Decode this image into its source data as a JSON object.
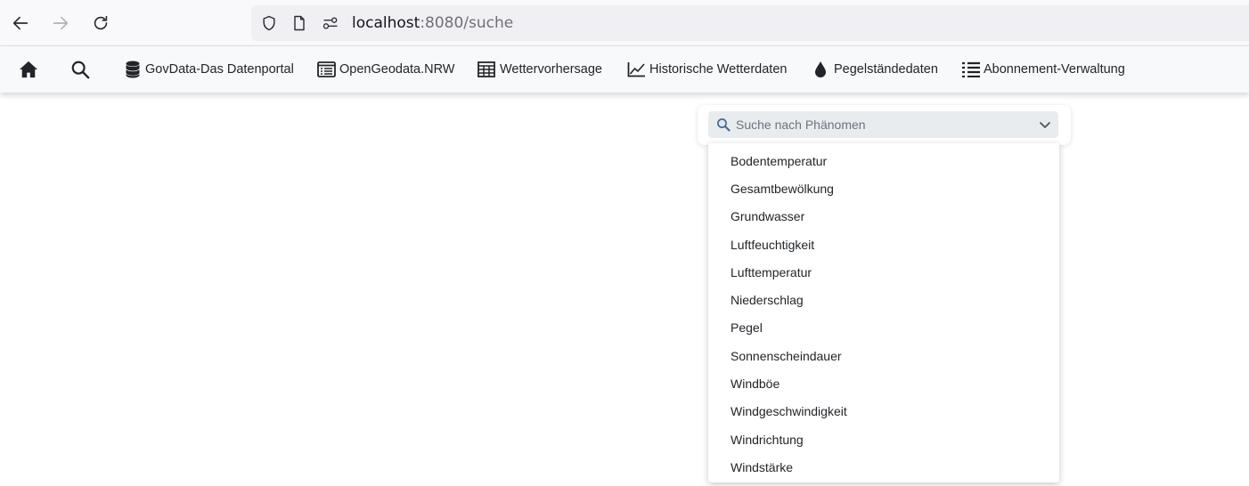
{
  "browser": {
    "url_host": "localhost",
    "url_rest": ":8080/suche",
    "back_icon": "arrow-left-icon",
    "forward_icon": "arrow-right-icon",
    "reload_icon": "reload-icon"
  },
  "navbar": {
    "home_icon": "home-icon",
    "search_icon": "search-icon",
    "links": [
      {
        "label": "GovData-Das Datenportal",
        "icon": "database-icon"
      },
      {
        "label": "OpenGeodata.NRW",
        "icon": "window-list-icon"
      },
      {
        "label": "Wettervorhersage",
        "icon": "table-icon"
      },
      {
        "label": "Historische Wetterdaten",
        "icon": "line-chart-icon"
      },
      {
        "label": "Pegelständedaten",
        "icon": "droplet-icon"
      },
      {
        "label": "Abonnement-Verwaltung",
        "icon": "list-icon"
      }
    ]
  },
  "search": {
    "placeholder": "Suche nach Phänomen",
    "options": [
      "Bodentemperatur",
      "Gesamtbewölkung",
      "Grundwasser",
      "Luftfeuchtigkeit",
      "Lufttemperatur",
      "Niederschlag",
      "Pegel",
      "Sonnenscheindauer",
      "Windböe",
      "Windgeschwindigkeit",
      "Windrichtung",
      "Windstärke"
    ]
  },
  "colors": {
    "navbar_bg": "#f8f9fa",
    "select_bg": "#e9ecef",
    "text": "#212529",
    "placeholder": "#6c757d"
  }
}
